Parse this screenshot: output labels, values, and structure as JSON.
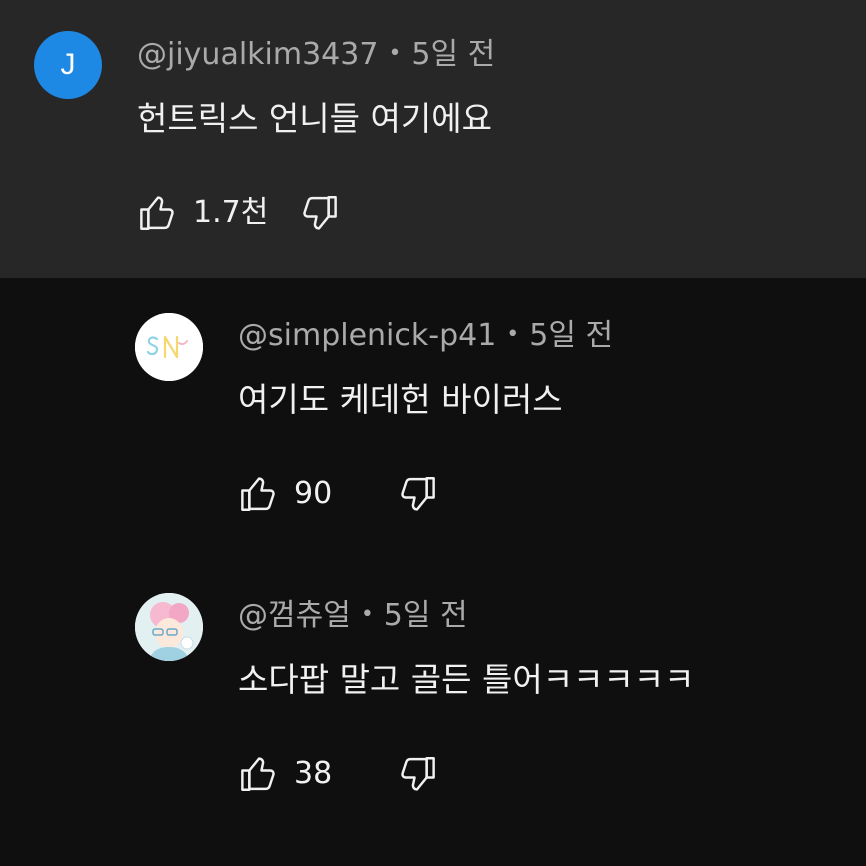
{
  "comments": [
    {
      "avatar_letter": "J",
      "author": "@jiyualkim3437",
      "separator": "•",
      "time": "5일 전",
      "text": "헌트릭스 언니들 여기에요",
      "likes": "1.7천",
      "avatar_color": "#1e88e5",
      "like_icon": "thumbs-up-icon",
      "dislike_icon": "thumbs-down-icon"
    },
    {
      "author": "@simplenick-p41",
      "separator": "•",
      "time": "5일 전",
      "text": "여기도 케데헌 바이러스",
      "likes": "90",
      "like_icon": "thumbs-up-icon",
      "dislike_icon": "thumbs-down-icon"
    },
    {
      "author": "@껌츄얼",
      "separator": "•",
      "time": "5일 전",
      "text": "소다팝 말고 골든 틀어ㅋㅋㅋㅋㅋ",
      "likes": "38",
      "like_icon": "thumbs-up-icon",
      "dislike_icon": "thumbs-down-icon"
    }
  ],
  "colors": {
    "background": "#0f0f0f",
    "highlight_background": "#272727",
    "primary_text": "#f1f1f1",
    "secondary_text": "#aaaaaa"
  }
}
